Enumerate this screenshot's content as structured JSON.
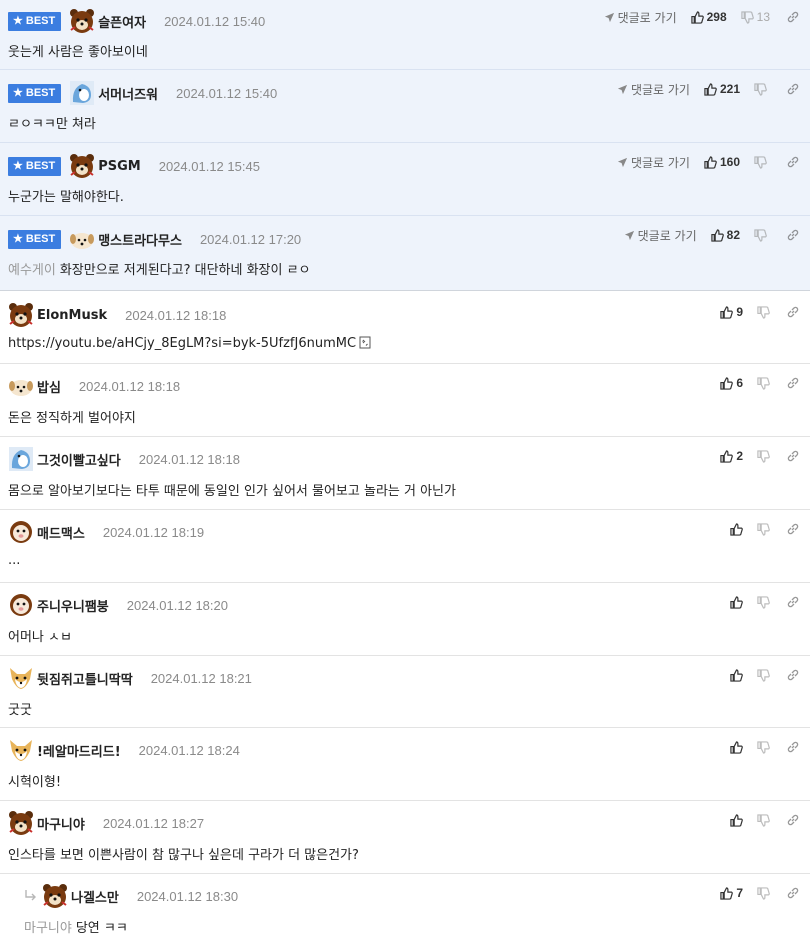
{
  "ui": {
    "best_label": "BEST",
    "goto_label": "댓글로 가기"
  },
  "comments": [
    {
      "nick": "슬픈여자",
      "time": "2024.01.12 15:40",
      "text": "웃는게 사람은 좋아보이네",
      "up": "298",
      "down": "13",
      "best": true,
      "avatar": "bear"
    },
    {
      "nick": "서머너즈워",
      "time": "2024.01.12 15:40",
      "text": "ㄹㅇㅋㅋ만 쳐라",
      "up": "221",
      "down": "",
      "best": true,
      "avatar": "whale"
    },
    {
      "nick": "PSGM",
      "time": "2024.01.12 15:45",
      "text": "누군가는 말해야한다.",
      "up": "160",
      "down": "",
      "best": true,
      "avatar": "bear"
    },
    {
      "nick": "맹스트라다무스",
      "time": "2024.01.12 17:20",
      "mention": "예수게이",
      "text": "화장만으로 저게된다고? 대단하네 화장이 ㄹㅇ",
      "up": "82",
      "down": "",
      "best": true,
      "avatar": "puppy"
    },
    {
      "nick": "ElonMusk",
      "time": "2024.01.12 18:18",
      "text": "https://youtu.be/aHCjy_8EgLM?si=byk-5UfzfJ6numMC",
      "up": "9",
      "down": "",
      "best": false,
      "avatar": "bear",
      "has_link": true
    },
    {
      "nick": "밥심",
      "time": "2024.01.12 18:18",
      "text": "돈은 정직하게 벌어야지",
      "up": "6",
      "down": "",
      "best": false,
      "avatar": "puppy"
    },
    {
      "nick": "그것이빨고싶다",
      "time": "2024.01.12 18:18",
      "text": "몸으로 알아보기보다는 타투 때문에 동일인 인가 싶어서 물어보고 놀라는 거 아닌가",
      "up": "2",
      "down": "",
      "best": false,
      "avatar": "whale"
    },
    {
      "nick": "매드맥스",
      "time": "2024.01.12 18:19",
      "text": "...",
      "up": "",
      "down": "",
      "best": false,
      "avatar": "pig"
    },
    {
      "nick": "주니우니팸붕",
      "time": "2024.01.12 18:20",
      "text": "어머나 ㅅㅂ",
      "up": "",
      "down": "",
      "best": false,
      "avatar": "pig"
    },
    {
      "nick": "뒷짐쥐고틀니딱딱",
      "time": "2024.01.12 18:21",
      "text": "굿굿",
      "up": "",
      "down": "",
      "best": false,
      "avatar": "fox"
    },
    {
      "nick": "!레알마드리드!",
      "time": "2024.01.12 18:24",
      "text": "시혁이형!",
      "up": "",
      "down": "",
      "best": false,
      "avatar": "fox"
    },
    {
      "nick": "마구니야",
      "time": "2024.01.12 18:27",
      "text": "인스타를 보면 이쁜사람이 참 많구나 싶은데 구라가 더 많은건가?",
      "up": "",
      "down": "",
      "best": false,
      "avatar": "bear"
    },
    {
      "nick": "나겔스만",
      "time": "2024.01.12 18:30",
      "mention": "마구니야",
      "text": "당연 ㅋㅋ",
      "up": "7",
      "down": "",
      "best": false,
      "avatar": "bear",
      "reply": true
    }
  ]
}
